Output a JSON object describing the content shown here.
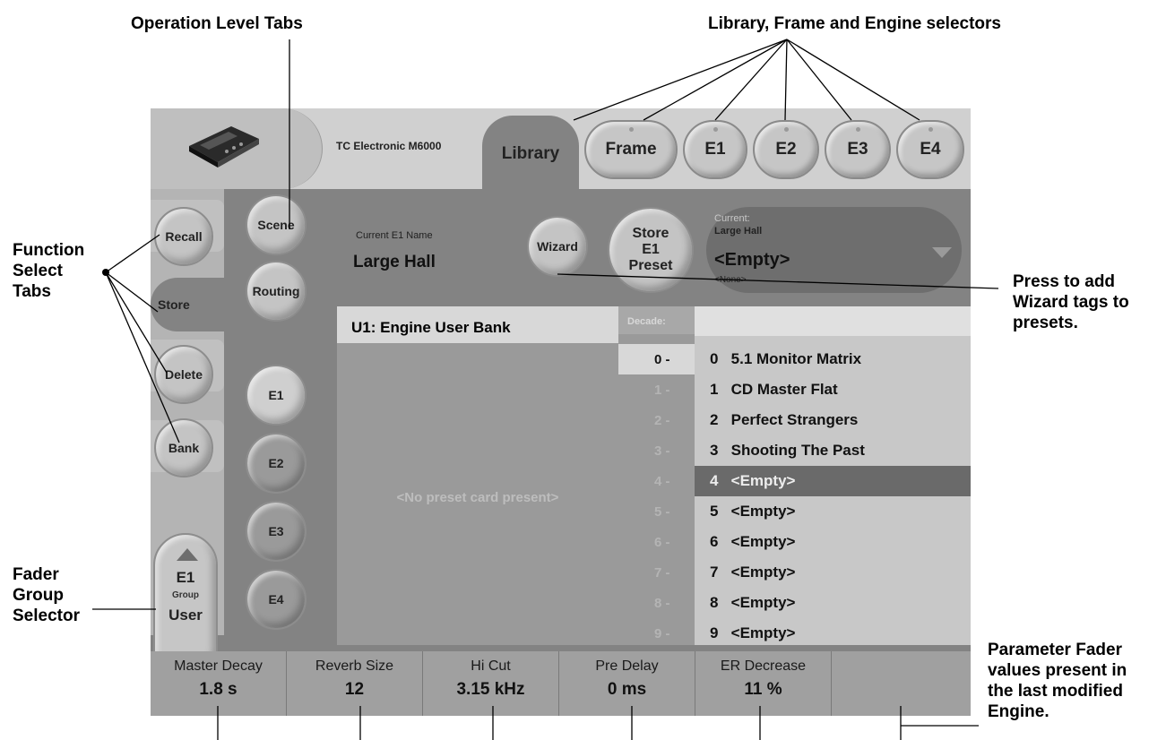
{
  "annotations": {
    "operation_level_tabs": "Operation Level Tabs",
    "selectors": "Library, Frame and Engine selectors",
    "function_select": [
      "Function",
      "Select",
      "Tabs"
    ],
    "fader_group": [
      "Fader",
      "Group",
      "Selector"
    ],
    "wizard_note": [
      "Press to add",
      "Wizard tags to",
      "presets."
    ],
    "fader_note": [
      "Parameter Fader",
      "values present in",
      "the last modified",
      "Engine."
    ]
  },
  "header": {
    "brand": "TC Electronic M6000",
    "tabs": [
      "Library",
      "Frame",
      "E1",
      "E2",
      "E3",
      "E4"
    ],
    "active_tab": "Library"
  },
  "function_tabs": {
    "recall": "Recall",
    "store": "Store",
    "delete": "Delete",
    "bank": "Bank",
    "active": "Store"
  },
  "fader_group": {
    "engine": "E1",
    "group_label": "Group",
    "group": "User"
  },
  "operation_tabs": [
    "Scene",
    "Routing",
    "E1",
    "E2",
    "E3",
    "E4"
  ],
  "current": {
    "name_label": "Current E1 Name",
    "name": "Large Hall",
    "wizard_button": "Wizard",
    "store_button": [
      "Store",
      "E1",
      "Preset"
    ],
    "preset_label": "Current:",
    "preset_current": "Large Hall",
    "preset_target": "<Empty>",
    "preset_tag": "<None>"
  },
  "bank": {
    "title": "U1:   Engine User Bank",
    "empty_message": "<No preset card present>"
  },
  "decades": {
    "label": "Decade:",
    "items": [
      "0 -",
      "1 -",
      "2 -",
      "3 -",
      "4 -",
      "5 -",
      "6 -",
      "7 -",
      "8 -",
      "9 -"
    ],
    "active_index": 0
  },
  "presets": {
    "items": [
      {
        "num": "0",
        "name": "5.1 Monitor Matrix"
      },
      {
        "num": "1",
        "name": "CD Master Flat"
      },
      {
        "num": "2",
        "name": "Perfect Strangers"
      },
      {
        "num": "3",
        "name": "Shooting The Past"
      },
      {
        "num": "4",
        "name": "<Empty>"
      },
      {
        "num": "5",
        "name": "<Empty>"
      },
      {
        "num": "6",
        "name": "<Empty>"
      },
      {
        "num": "7",
        "name": "<Empty>"
      },
      {
        "num": "8",
        "name": "<Empty>"
      },
      {
        "num": "9",
        "name": "<Empty>"
      }
    ],
    "selected_index": 4
  },
  "faders": [
    {
      "name": "Master Decay",
      "value": "1.8 s"
    },
    {
      "name": "Reverb Size",
      "value": "12"
    },
    {
      "name": "Hi Cut",
      "value": "3.15 kHz"
    },
    {
      "name": "Pre Delay",
      "value": "0 ms"
    },
    {
      "name": "ER Decrease",
      "value": "11 %"
    },
    {
      "name": "",
      "value": ""
    }
  ]
}
